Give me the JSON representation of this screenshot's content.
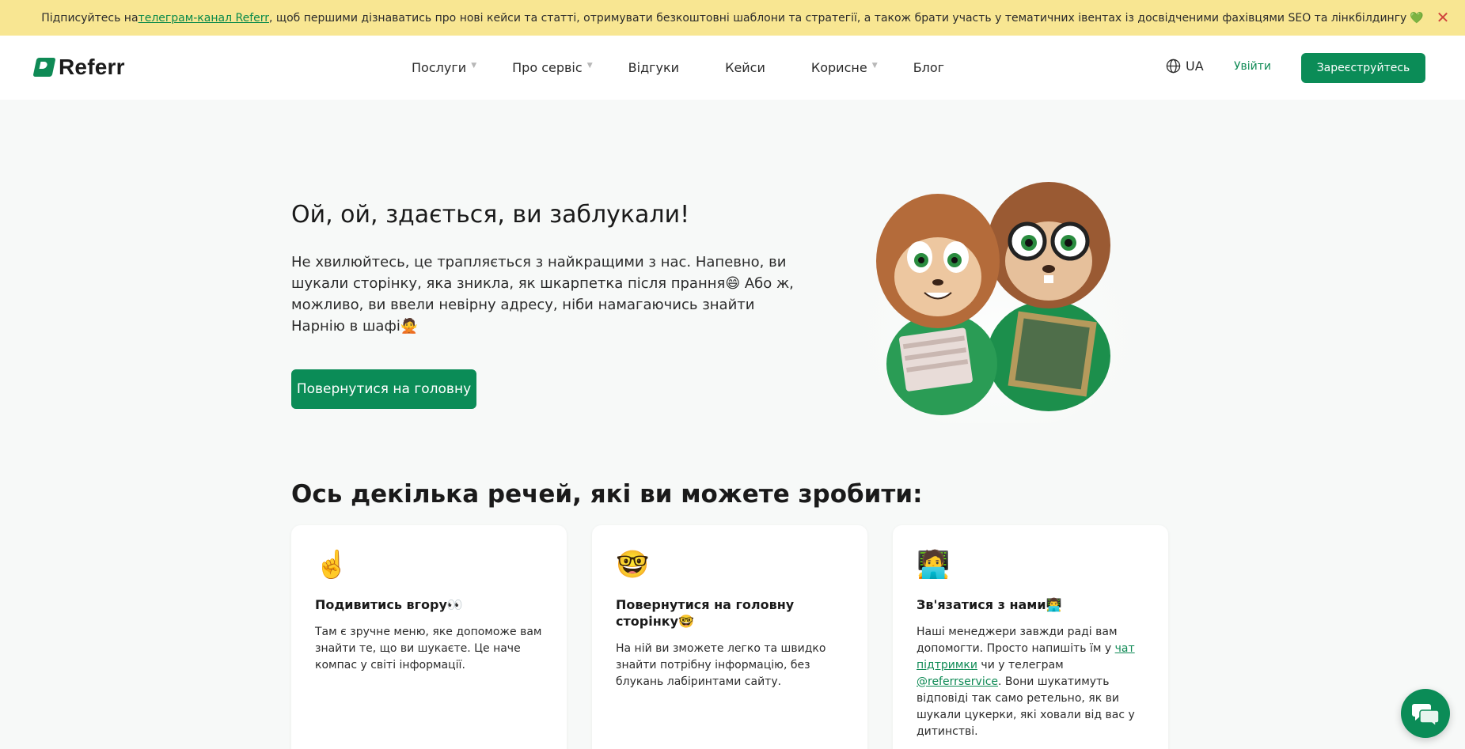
{
  "banner": {
    "text_before": "Підписуйтесь на ",
    "link": "телеграм-канал Referr",
    "text_after": ", щоб першими дізнаватись про нові кейси та статті, отримувати безкоштовні шаблони та стратегії, а також брати участь у тематичних івентах із досвідченими фахівцями SEO та лінкбілдингу",
    "heart": "💚",
    "close": "✕"
  },
  "header": {
    "logo": "Referr",
    "nav": [
      {
        "label": "Послуги",
        "dropdown": true
      },
      {
        "label": "Про сервіс",
        "dropdown": true
      },
      {
        "label": "Відгуки",
        "dropdown": false
      },
      {
        "label": "Кейси",
        "dropdown": false
      },
      {
        "label": "Корисне",
        "dropdown": true
      },
      {
        "label": "Блог",
        "dropdown": false
      }
    ],
    "lang": "UA",
    "login": "Увійти",
    "signup": "Зареєструйтесь"
  },
  "hero": {
    "title": "Ой, ой, здається, ви заблукали!",
    "text": "Не хвилюйтесь, це трапляється з найкращими з нас. Напевно, ви шукали сторінку, яка зникла, як шкарпетка після прання😄 Або ж, можливо, ви ввели невірну адресу, ніби намагаючись знайти Нарнію в шафі🙅",
    "button": "Повернутися на головну"
  },
  "section": {
    "title": "Ось декілька речей, які ви можете зробити:"
  },
  "cards": [
    {
      "icon": "☝️",
      "title": "Подивитись вгору👀",
      "text": "Там є зручне меню, яке допоможе вам знайти те, що ви шукаєте. Це наче компас у світі інформації."
    },
    {
      "icon": "🤓",
      "title": "Повернутися на головну сторінку🤓",
      "text": "На ній ви зможете легко та швидко знайти потрібну інформацію, без блукань лабіринтами сайту."
    },
    {
      "icon": "🧑‍💻",
      "title": "Зв'язатися з нами👨‍💻",
      "text_1": "Наші менеджери завжди раді вам допомогти. Просто напишіть їм у ",
      "link_1": "чат підтримки",
      "text_2": " чи у телеграм ",
      "link_2": "@referrservice",
      "text_3": ". Вони шукатимуть відповіді так само ретельно, як ви шукали цукерки, які ховали від вас у дитинстві."
    }
  ],
  "colors": {
    "brand_green": "#0b8c57",
    "banner_bg": "#f8e692",
    "page_bg": "#f7f9f8"
  }
}
